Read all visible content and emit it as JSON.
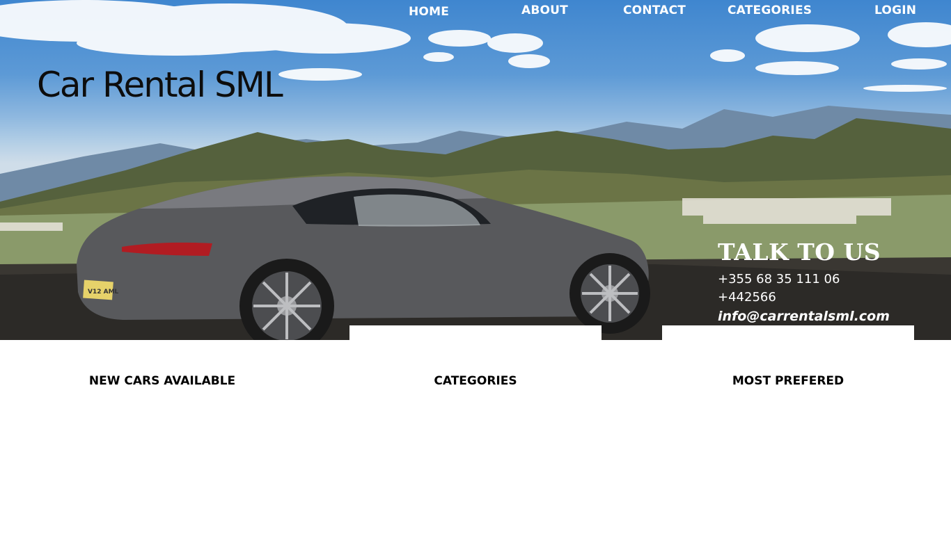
{
  "nav": {
    "home": "HOME",
    "about": "ABOUT",
    "contact": "CONTACT",
    "categories": "CATEGORIES",
    "login": "LOGIN"
  },
  "hero": {
    "brand": "Car Rental SML",
    "plate": "V12 AML"
  },
  "talk": {
    "title": "TALK TO US",
    "phone1": "+355 68 35 111 06",
    "phone2": "+442566",
    "email": "info@carrentalsml.com"
  },
  "sections": {
    "new_cars": "NEW CARS AVAILABLE",
    "categories": "CATEGORIES",
    "most_prefered": "MOST PREFERED"
  },
  "colors": {
    "nav_text": "#ffffff",
    "brand_text": "#0d0d0d",
    "section_text": "#000000"
  }
}
